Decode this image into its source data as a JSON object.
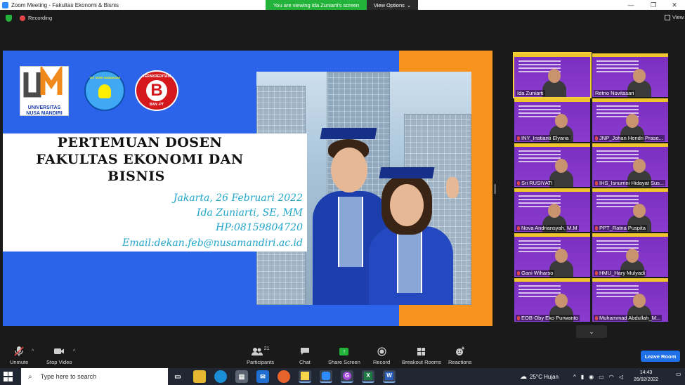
{
  "window": {
    "title": "Zoom Meeting - Fakultas Ekonomi & Bisnis",
    "viewing_banner": "You are viewing Ida Zuniarti's screen",
    "view_options": "View Options",
    "recording": "Recording",
    "view": "View"
  },
  "slide": {
    "logo_university": "UNIVERSITAS\nNUSA MANDIRI",
    "logo_tutwuri": "TUT WURI HANDAYANI",
    "logo_accreditation_top": "TERAKREDITASI",
    "logo_accreditation_letter": "B",
    "logo_accreditation_bottom": "BAN -PT",
    "heading_line1": "PERTEMUAN DOSEN",
    "heading_line2": "FAKULTAS EKONOMI DAN",
    "heading_line3": "BISNIS",
    "date": "Jakarta, 26 Februari 2022",
    "presenter": "Ida Zuniarti, SE, MM",
    "phone": "HP:08159804720",
    "email": "Email:dekan.feb@nusamandiri.ac.id"
  },
  "participants": [
    {
      "name": "Ida Zuniarti",
      "muted": false,
      "active": true
    },
    {
      "name": "Retno Novitasari",
      "muted": false,
      "active": false
    },
    {
      "name": "INY_Instianti Elyana",
      "muted": true,
      "active": false
    },
    {
      "name": "JNP_Johan Hendri Prase...",
      "muted": true,
      "active": false
    },
    {
      "name": "Sri RUSIYATI",
      "muted": true,
      "active": false
    },
    {
      "name": "IHS_Isnurrini Hidayat Sus...",
      "muted": true,
      "active": false
    },
    {
      "name": "Nova Andriansyah, M.M",
      "muted": true,
      "active": false
    },
    {
      "name": "PPT_Ratna Puspita",
      "muted": true,
      "active": false
    },
    {
      "name": "Gani Wiharso",
      "muted": true,
      "active": false
    },
    {
      "name": "HMU_Hary Mulyadi",
      "muted": true,
      "active": false
    },
    {
      "name": "EOB-Oby Eko Purwanto",
      "muted": true,
      "active": false
    },
    {
      "name": "Muhammad Abdullah_M...",
      "muted": true,
      "active": false
    }
  ],
  "toolbar": {
    "unmute": "Unmute",
    "stop_video": "Stop Video",
    "participants": "Participants",
    "participants_count": "21",
    "chat": "Chat",
    "share_screen": "Share Screen",
    "record": "Record",
    "breakout_rooms": "Breakout Rooms",
    "reactions": "Reactions",
    "leave_room": "Leave Room"
  },
  "taskbar": {
    "search_placeholder": "Type here to search",
    "weather": "25°C Hujan",
    "time": "14:43",
    "date": "26/02/2022"
  }
}
